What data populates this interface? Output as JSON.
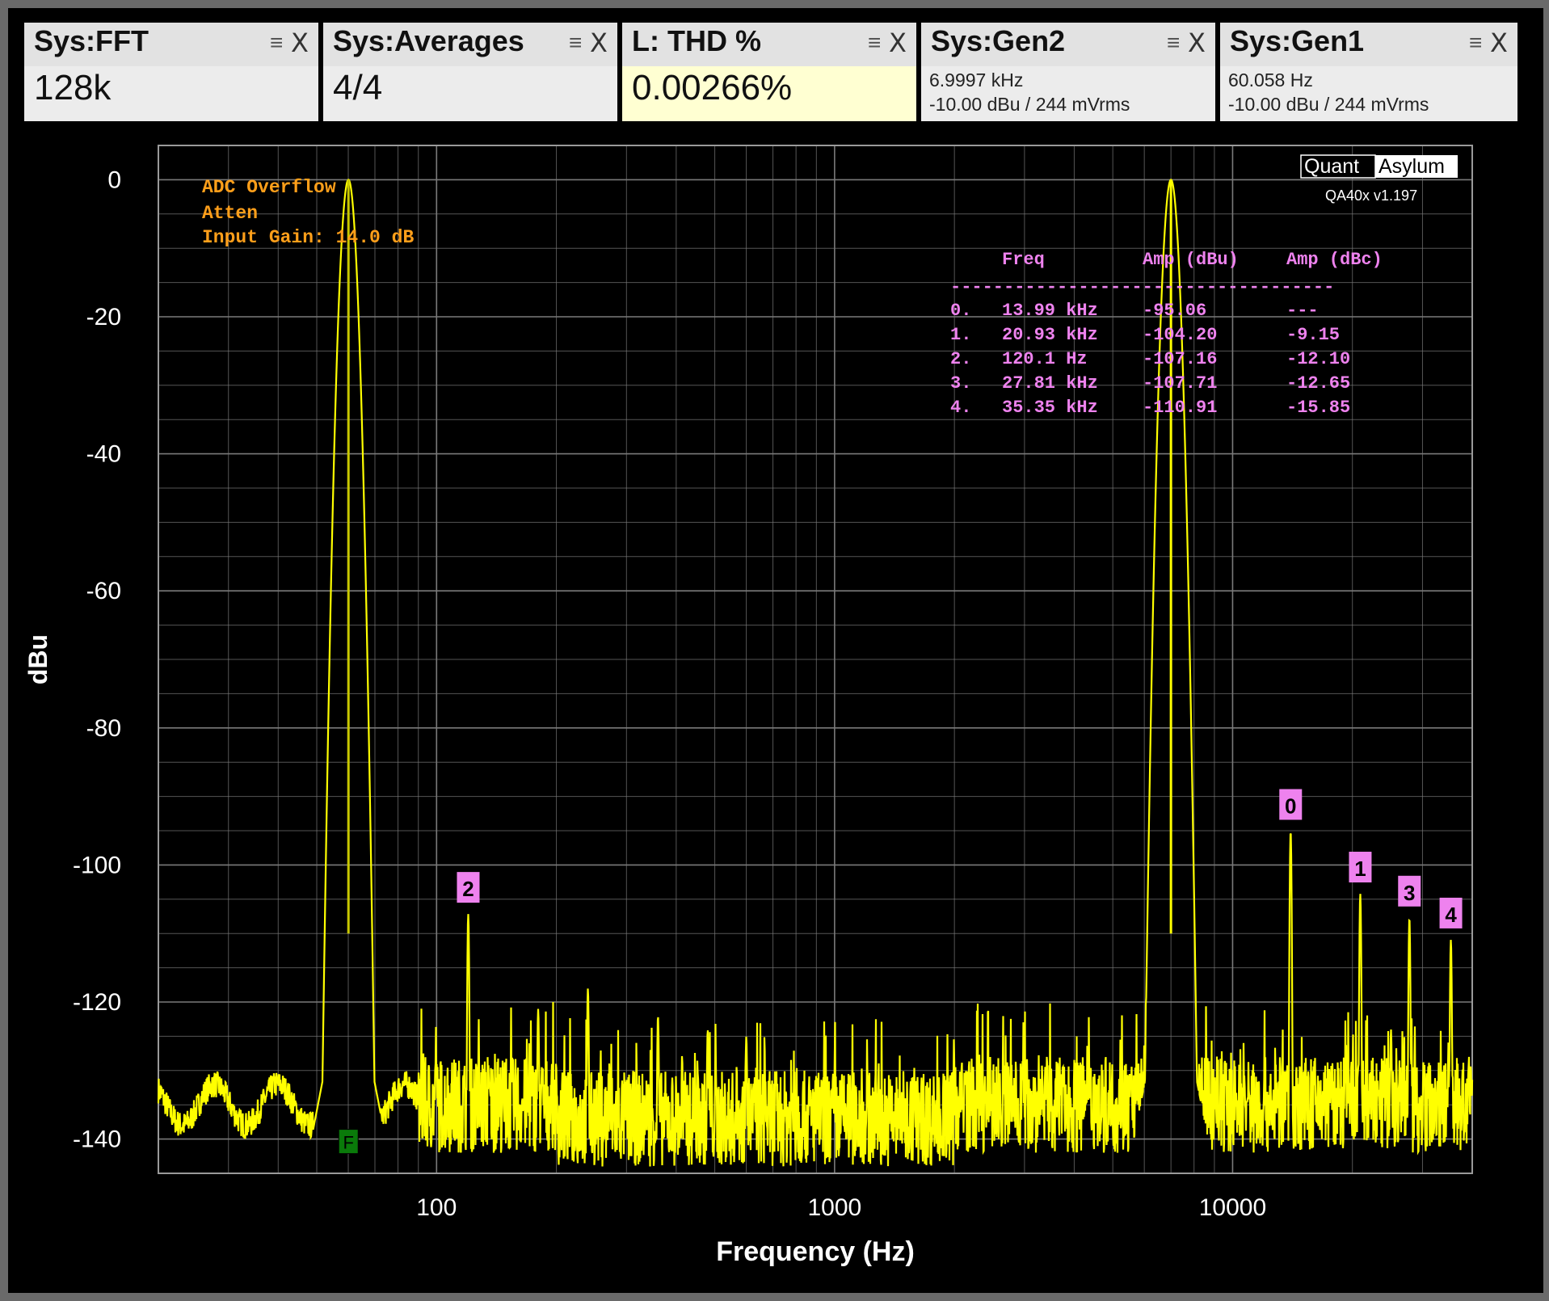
{
  "tiles": [
    {
      "title": "Sys:FFT",
      "value": "128k"
    },
    {
      "title": "Sys:Averages",
      "value": "4/4"
    },
    {
      "title": "L: THD %",
      "value": "0.00266%"
    },
    {
      "title": "Sys:Gen2",
      "line1": "6.9997 kHz",
      "line2": "-10.00 dBu  / 244 mVrms"
    },
    {
      "title": "Sys:Gen1",
      "line1": "60.058 Hz",
      "line2": "-10.00 dBu  / 244 mVrms"
    }
  ],
  "colors": {
    "trace": "#ffff00",
    "trace_dim": "#c8c800",
    "grid": "#7a7a7a",
    "warning": "#ff9f1a",
    "marker": "#ee82ee",
    "text": "#ffffff",
    "thd_tile": "#ffffd2",
    "fundamental_flag": "#0a7a0a"
  },
  "warnings": [
    "ADC Overflow",
    "Atten",
    "Input Gain: 14.0 dB"
  ],
  "logo": {
    "left": "Quant",
    "right": "Asylum",
    "version": "QA40x v1.197"
  },
  "harmonics_table": {
    "headers": [
      "Freq",
      "Amp (dBu)",
      "Amp (dBc)"
    ],
    "separator": "------------------------------------",
    "rows": [
      {
        "idx": "0.",
        "freq": "13.99 kHz",
        "dbu": "-95.06",
        "dbc": "---"
      },
      {
        "idx": "1.",
        "freq": "20.93 kHz",
        "dbu": "-104.20",
        "dbc": "-9.15"
      },
      {
        "idx": "2.",
        "freq": "120.1 Hz",
        "dbu": "-107.16",
        "dbc": "-12.10"
      },
      {
        "idx": "3.",
        "freq": "27.81 kHz",
        "dbu": "-107.71",
        "dbc": "-12.65"
      },
      {
        "idx": "4.",
        "freq": "35.35 kHz",
        "dbu": "-110.91",
        "dbc": "-15.85"
      }
    ]
  },
  "fundamental_marker": "F",
  "chart_data": {
    "type": "line",
    "xlabel": "Frequency (Hz)",
    "ylabel": "dBu",
    "x_scale": "log",
    "xlim": [
      20,
      40000
    ],
    "ylim": [
      -145,
      5
    ],
    "x_ticks": [
      100,
      1000,
      10000
    ],
    "x_tick_labels": [
      "100",
      "1000",
      "10000"
    ],
    "y_ticks": [
      0,
      -20,
      -40,
      -60,
      -80,
      -100,
      -120,
      -140
    ],
    "y_tick_labels": [
      "0",
      "-20",
      "-40",
      "-60",
      "-80",
      "-100",
      "-120",
      "-140"
    ],
    "grid": true,
    "noise_floor_dbu": -135,
    "peaks": [
      {
        "freq": 60.058,
        "dbu": 0
      },
      {
        "freq": 6999.7,
        "dbu": 0
      },
      {
        "freq": 120.1,
        "dbu": -107.16
      },
      {
        "freq": 180,
        "dbu": -121
      },
      {
        "freq": 240,
        "dbu": -118
      },
      {
        "freq": 360,
        "dbu": -122
      },
      {
        "freq": 480,
        "dbu": -124
      },
      {
        "freq": 600,
        "dbu": -125
      },
      {
        "freq": 13990,
        "dbu": -95.06
      },
      {
        "freq": 20930,
        "dbu": -104.2
      },
      {
        "freq": 25000,
        "dbu": -124
      },
      {
        "freq": 27810,
        "dbu": -107.71
      },
      {
        "freq": 35350,
        "dbu": -110.91
      }
    ],
    "markers": [
      {
        "label": "0",
        "freq": 13990,
        "dbu": -95.06
      },
      {
        "label": "1",
        "freq": 20930,
        "dbu": -104.2
      },
      {
        "label": "2",
        "freq": 120.1,
        "dbu": -107.16
      },
      {
        "label": "3",
        "freq": 27810,
        "dbu": -107.71
      },
      {
        "label": "4",
        "freq": 35350,
        "dbu": -110.91
      }
    ]
  }
}
